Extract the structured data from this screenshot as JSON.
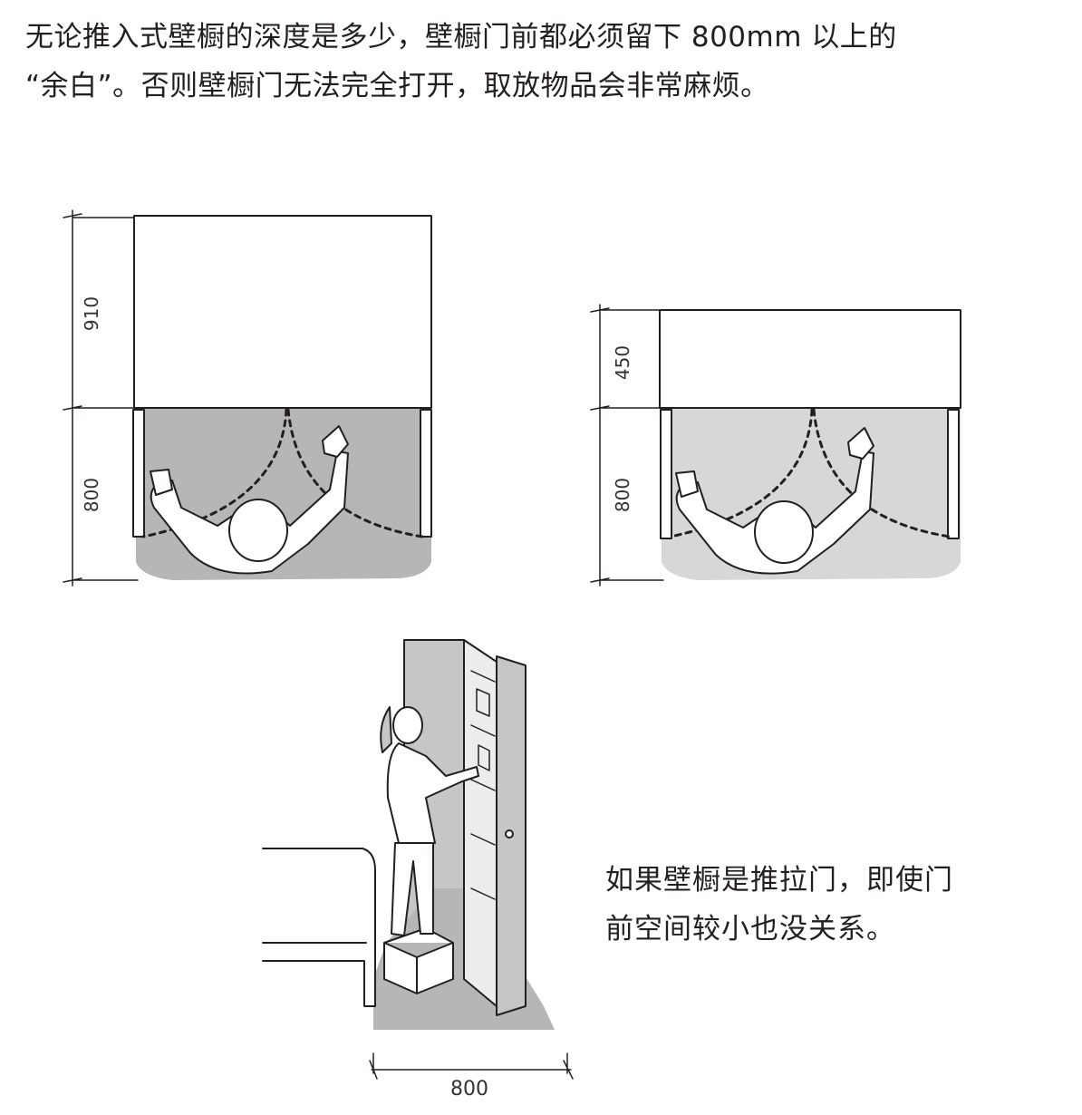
{
  "intro": {
    "line1": "无论推入式壁橱的深度是多少，壁橱门前都必须留下 800mm 以上的",
    "line2": "“余白”。否则壁橱门无法完全打开，取放物品会非常麻烦。"
  },
  "left_plan": {
    "closet_depth_label": "910",
    "clearance_label": "800"
  },
  "right_plan": {
    "closet_depth_label": "450",
    "clearance_label": "800"
  },
  "bottom_scene": {
    "width_label": "800"
  },
  "note": {
    "line1": "如果壁橱是推拉门，即使门",
    "line2": "前空间较小也没关系。"
  },
  "colors": {
    "floor_left": "#b7b6b6",
    "floor_right": "#d7d7d7",
    "wall": "#c6c6c6",
    "ink": "#231f20"
  }
}
